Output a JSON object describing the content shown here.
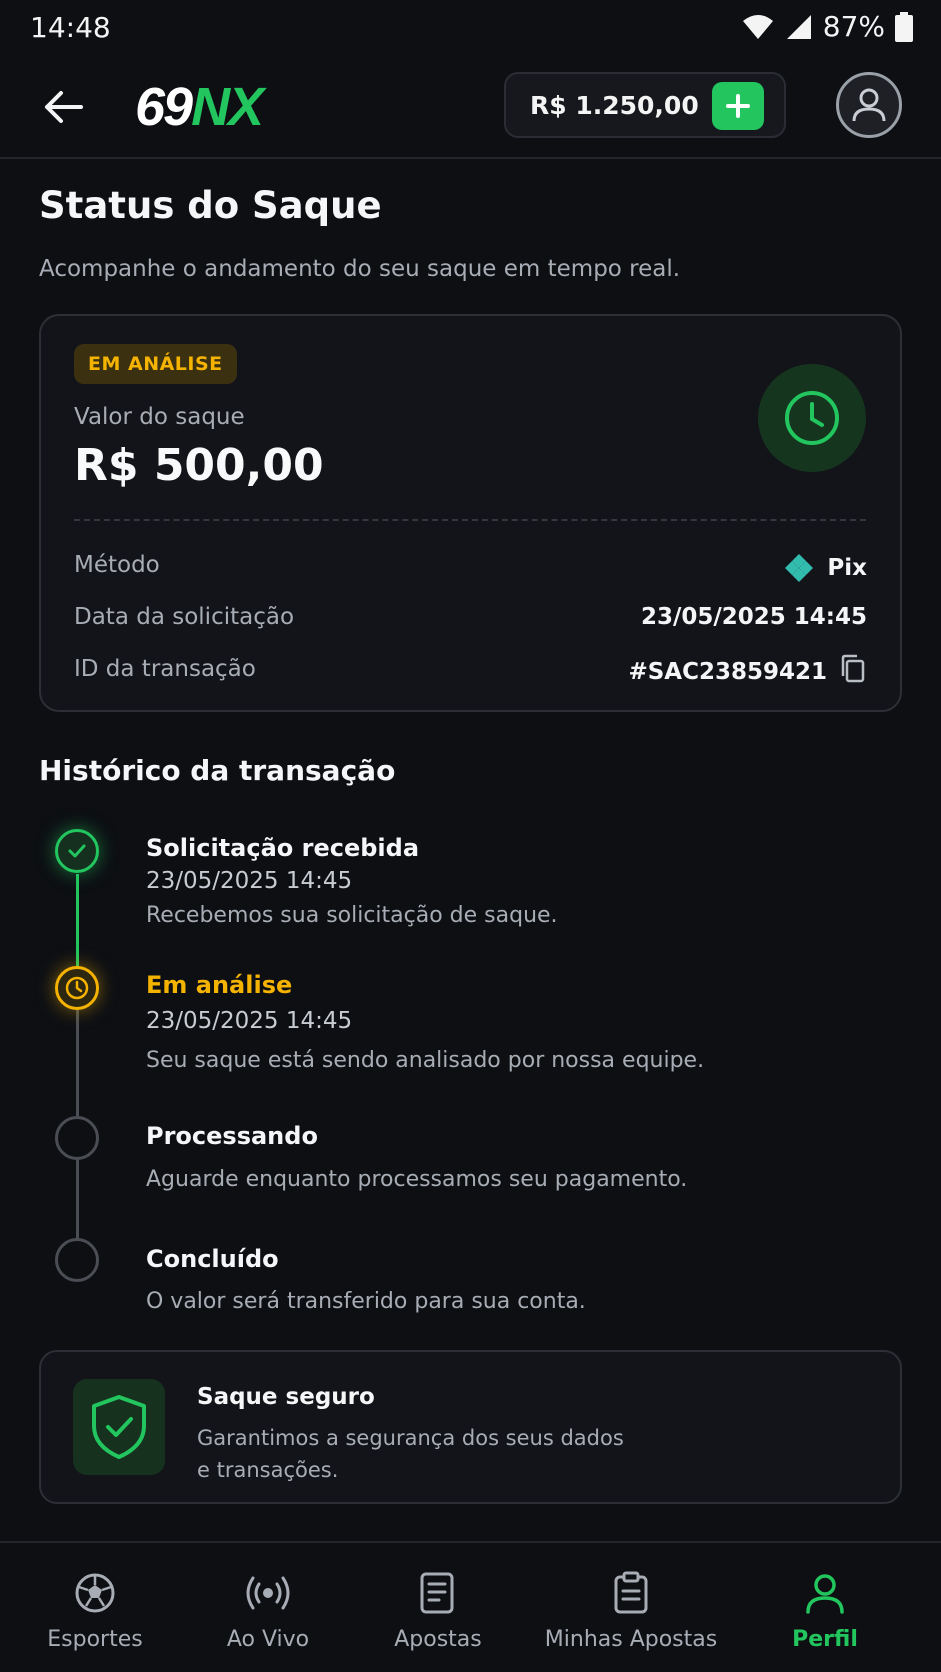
{
  "status_bar": {
    "time": "14:48",
    "battery": "87%"
  },
  "header": {
    "logo_part1": "69",
    "logo_part2": "NX",
    "balance": "R$ 1.250,00"
  },
  "page": {
    "title": "Status do Saque",
    "subtitle": "Acompanhe o andamento do seu saque em tempo real."
  },
  "card": {
    "badge": "EM ANÁLISE",
    "amount_label": "Valor do saque",
    "amount_value": "R$ 500,00",
    "rows": [
      {
        "label": "Método",
        "value": "Pix"
      },
      {
        "label": "Data da solicitação",
        "value": "23/05/2025 14:45"
      },
      {
        "label": "ID da transação",
        "value": "#SAC23859421"
      }
    ]
  },
  "history": {
    "title": "Histórico da transação",
    "steps": [
      {
        "title": "Solicitação recebida",
        "date": "23/05/2025 14:45",
        "desc": "Recebemos sua solicitação de saque.",
        "state": "done"
      },
      {
        "title": "Em análise",
        "date": "23/05/2025 14:45",
        "desc": "Seu saque está sendo analisado por nossa equipe.",
        "state": "current"
      },
      {
        "title": "Processando",
        "desc": "Aguarde enquanto processamos seu pagamento.",
        "state": "pending"
      },
      {
        "title": "Concluído",
        "desc": "O valor será transferido para sua conta.",
        "state": "pending"
      }
    ]
  },
  "secure": {
    "title": "Saque seguro",
    "desc_line1": "Garantimos a segurança dos seus dados",
    "desc_line2": "e transações."
  },
  "bottom_nav": [
    {
      "label": "Esportes",
      "icon": "soccer-ball-icon"
    },
    {
      "label": "Ao Vivo",
      "icon": "live-broadcast-icon"
    },
    {
      "label": "Apostas",
      "icon": "bet-slip-icon"
    },
    {
      "label": "Minhas Apostas",
      "icon": "clipboard-icon"
    },
    {
      "label": "Perfil",
      "icon": "user-icon",
      "active": true
    }
  ],
  "colors": {
    "accent_green": "#22c55e",
    "warning_yellow": "#f5b301",
    "background": "#0d0f13",
    "card_background": "#121419"
  }
}
